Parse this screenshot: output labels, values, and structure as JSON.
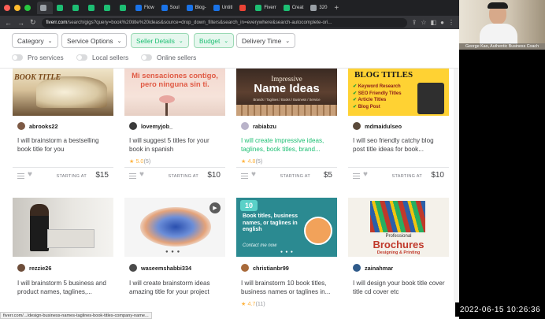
{
  "browser": {
    "tabs": [
      {
        "label": "",
        "fav": "#9aa0a6"
      },
      {
        "label": "",
        "fav": "#1dbf73"
      },
      {
        "label": "",
        "fav": "#1dbf73"
      },
      {
        "label": "",
        "fav": "#1dbf73"
      },
      {
        "label": "",
        "fav": "#1dbf73"
      },
      {
        "label": "",
        "fav": "#1dbf73"
      },
      {
        "label": "Flow",
        "fav": "#1a73e8"
      },
      {
        "label": "Soul",
        "fav": "#1a73e8"
      },
      {
        "label": "Blog-",
        "fav": "#1a73e8"
      },
      {
        "label": "Untitl",
        "fav": "#1a73e8"
      },
      {
        "label": "",
        "fav": "#ea4335"
      },
      {
        "label": "Fiverr",
        "fav": "#1dbf73"
      },
      {
        "label": "Creat",
        "fav": "#1dbf73"
      },
      {
        "label": "320",
        "fav": "#9aa0a6"
      }
    ],
    "url_host": "fiverr.com",
    "url_path": "/search/gigs?query=book%20title%20ideas&source=drop_down_filters&search_in=everywhere&search-autocomplete-ori..."
  },
  "filters": {
    "buttons": [
      {
        "label": "Category"
      },
      {
        "label": "Service Options"
      },
      {
        "label": "Seller Details"
      },
      {
        "label": "Budget"
      },
      {
        "label": "Delivery Time"
      }
    ],
    "toggles": [
      {
        "label": "Pro services"
      },
      {
        "label": "Local sellers"
      },
      {
        "label": "Online sellers"
      }
    ]
  },
  "gigs": [
    {
      "seller": "abrooks22",
      "title": "I will brainstorm a bestselling book title for you",
      "rating": "",
      "rating_count": "",
      "starting": "STARTING AT",
      "price": "$15",
      "thumb_text": "BOOK TITLE"
    },
    {
      "seller": "lovemyjob_",
      "title": "I will suggest 5 titles for your book in spanish",
      "rating": "★ 5.0",
      "rating_count": "(5)",
      "starting": "STARTING AT",
      "price": "$10",
      "thumb_text": "Mi sensaciones contigo, pero ninguna sin ti."
    },
    {
      "seller": "rabiabzu",
      "title": "I will create impressive ideas, taglines, book titles, brand...",
      "rating": "★ 4.8",
      "rating_count": "(5)",
      "starting": "STARTING AT",
      "price": "$5",
      "thumb_text": "Impressive",
      "thumb_text2": "Name Ideas",
      "thumb_text3": "Brands / Taglines / Books / Business / Service"
    },
    {
      "seller": "mdmaidulseo",
      "title": "I will seo friendly catchy blog post title ideas for book...",
      "rating": "",
      "rating_count": "",
      "starting": "STARTING AT",
      "price": "$10",
      "thumb_text": "BLOG TITLES",
      "thumb_list": [
        "Keyword Research",
        "SEO Friendly Titles",
        "Article Titles",
        "Blog Post"
      ]
    },
    {
      "seller": "rezzie26",
      "title": "I will brainstorm 5 business and product names, taglines,...",
      "rating": "",
      "rating_count": "",
      "starting": "",
      "price": "",
      "thumb_text": ""
    },
    {
      "seller": "waseemshabbi334",
      "title": "I will create brainstorm ideas amazing title for your project",
      "rating": "",
      "rating_count": "",
      "starting": "",
      "price": "",
      "thumb_text": ""
    },
    {
      "seller": "christianbr99",
      "title": "I will brainstorm 10 book titles, business names or taglines in...",
      "rating": "★ 4.7",
      "rating_count": "(11)",
      "starting": "",
      "price": "",
      "thumb_text": "Book titles, business names, or taglines in english",
      "thumb_num": "10",
      "thumb_contact": "Contact me now"
    },
    {
      "seller": "zainahmar",
      "title": "I will design your book title cover title cd cover etc",
      "rating": "",
      "rating_count": "",
      "starting": "",
      "price": "",
      "thumb_text": "Professional",
      "thumb_text2": "Brochures",
      "thumb_text3": "Designing & Printing"
    }
  ],
  "status_url": "fiverr.com/.../design-business-names-taglines-book-titles-company-name...",
  "webcam_label": "George Kao, Authentic Business Coach",
  "timestamp": "2022-06-15  10:26:36",
  "colors": {
    "fiverr_green": "#1dbf73",
    "star": "#ffb33e"
  }
}
